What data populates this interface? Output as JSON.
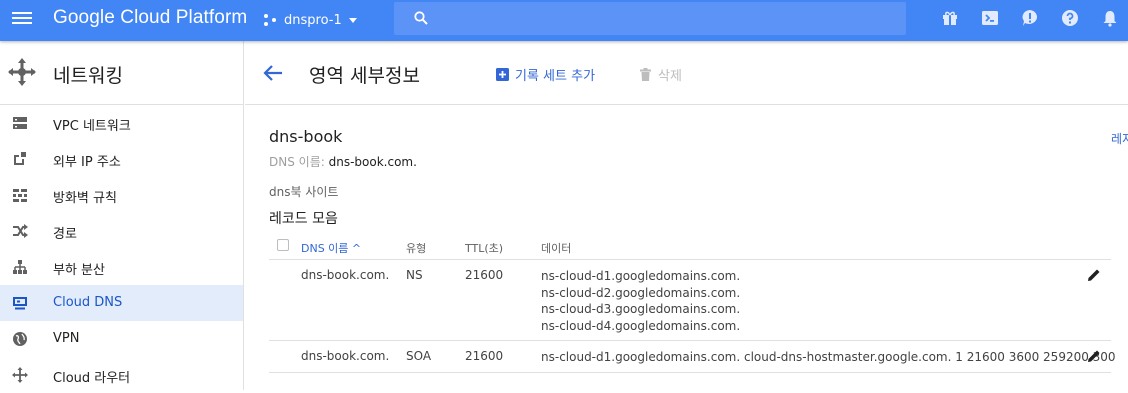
{
  "topbar": {
    "brand": "Google Cloud Platform",
    "project": "dnspro-1",
    "search_placeholder": ""
  },
  "nav": {
    "title": "네트워킹",
    "items": [
      {
        "label": "VPC 네트워크",
        "icon": "vpc-network-icon"
      },
      {
        "label": "외부 IP 주소",
        "icon": "external-ip-icon"
      },
      {
        "label": "방화벽 규칙",
        "icon": "firewall-icon"
      },
      {
        "label": "경로",
        "icon": "routes-icon"
      },
      {
        "label": "부하 분산",
        "icon": "load-balancing-icon"
      },
      {
        "label": "Cloud DNS",
        "icon": "cloud-dns-icon",
        "active": true
      },
      {
        "label": "VPN",
        "icon": "vpn-icon"
      },
      {
        "label": "Cloud 라우터",
        "icon": "cloud-router-icon"
      }
    ]
  },
  "header": {
    "title": "영역 세부정보",
    "add_label": "기록 세트 추가",
    "delete_label": "삭제"
  },
  "zone": {
    "name": "dns-book",
    "dns_label": "DNS 이름:",
    "dns_value": "dns-book.com.",
    "description": "dns북 사이트",
    "right_link": "레지"
  },
  "records": {
    "title": "레코드 모음",
    "columns": [
      "DNS 이름 ^",
      "유형",
      "TTL(초)",
      "데이터"
    ],
    "rows": [
      {
        "name": "dns-book.com.",
        "type": "NS",
        "ttl": "21600",
        "data": [
          "ns-cloud-d1.googledomains.com.",
          "ns-cloud-d2.googledomains.com.",
          "ns-cloud-d3.googledomains.com.",
          "ns-cloud-d4.googledomains.com."
        ]
      },
      {
        "name": "dns-book.com.",
        "type": "SOA",
        "ttl": "21600",
        "data": [
          "ns-cloud-d1.googledomains.com. cloud-dns-hostmaster.google.com. 1 21600 3600 259200 300"
        ]
      }
    ]
  },
  "colors": {
    "topbar": "#4285f4",
    "accent": "#3367d6",
    "active_nav_bg": "#e3ecfb"
  }
}
